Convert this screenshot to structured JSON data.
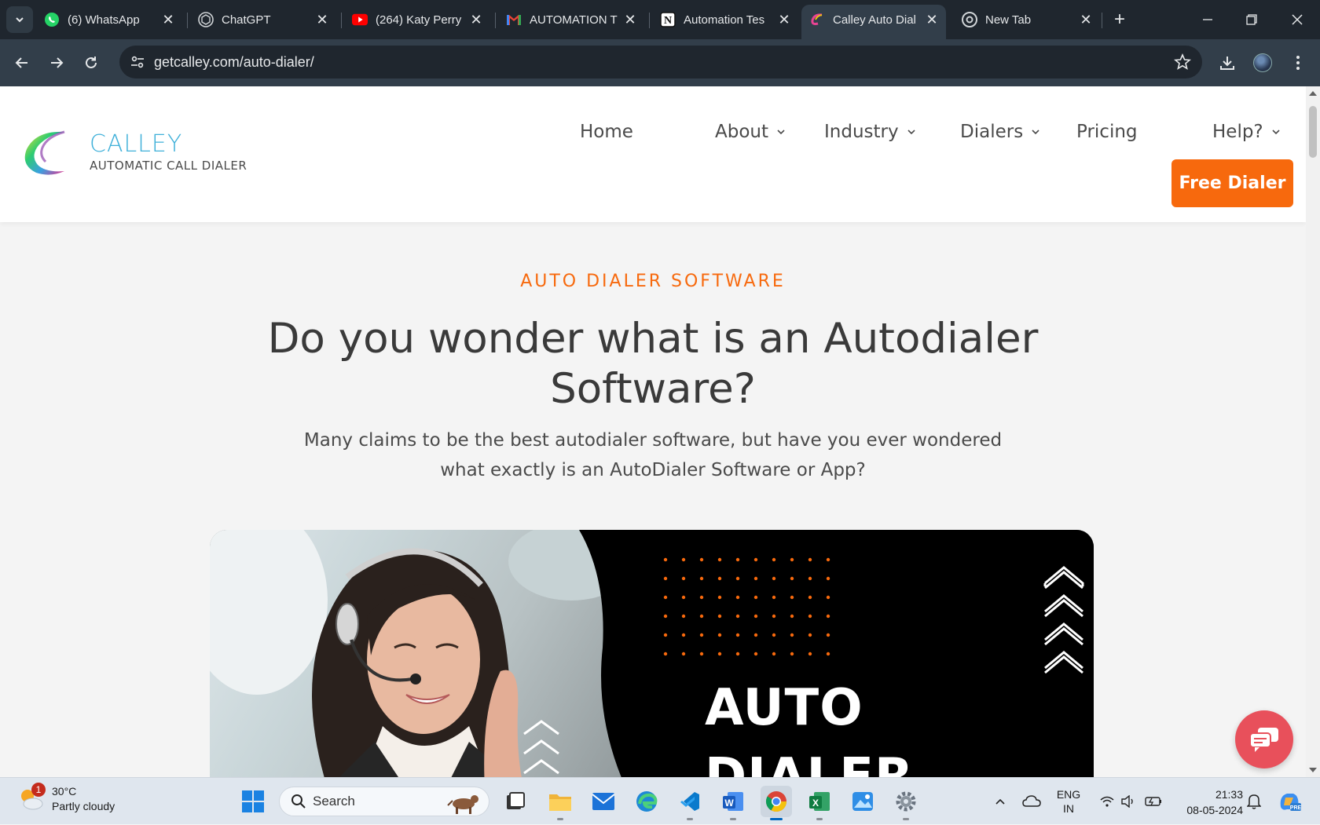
{
  "browser": {
    "tabs": [
      {
        "title": "(6) WhatsApp",
        "icon": "whatsapp-icon",
        "active": false
      },
      {
        "title": "ChatGPT",
        "icon": "chatgpt-icon",
        "active": false
      },
      {
        "title": "(264) Katy Perry",
        "icon": "youtube-icon",
        "active": false
      },
      {
        "title": "AUTOMATION T",
        "icon": "gmail-icon",
        "active": false
      },
      {
        "title": "Automation Tes",
        "icon": "notion-icon",
        "active": false
      },
      {
        "title": "Calley Auto Dial",
        "icon": "calley-icon",
        "active": true
      },
      {
        "title": "New Tab",
        "icon": "chrome-icon",
        "active": false
      }
    ],
    "url": "getcalley.com/auto-dialer/"
  },
  "site": {
    "logo": {
      "name": "CALLEY",
      "tagline": "AUTOMATIC CALL DIALER"
    },
    "nav": {
      "home": "Home",
      "about": "About",
      "industry": "Industry",
      "dialers": "Dialers",
      "pricing": "Pricing",
      "help": "Help?"
    },
    "cta": "Free Dialer",
    "hero": {
      "kicker": "AUTO DIALER SOFTWARE",
      "title": "Do you wonder what is an Autodialer Software?",
      "subtitle": "Many claims to be the best autodialer software, but have you ever wondered what exactly is an AutoDialer Software or App?"
    },
    "banner": {
      "word1": "AUTO",
      "word2": "DIALER"
    }
  },
  "colors": {
    "accent": "#f7690d",
    "brand_blue": "#3fb0d9",
    "chat": "#e8505b"
  },
  "taskbar": {
    "weather": {
      "temp": "30°C",
      "condition": "Partly cloudy",
      "badge": "1"
    },
    "search_label": "Search",
    "language": {
      "line1": "ENG",
      "line2": "IN"
    },
    "time": "21:33",
    "date": "08-05-2024"
  }
}
